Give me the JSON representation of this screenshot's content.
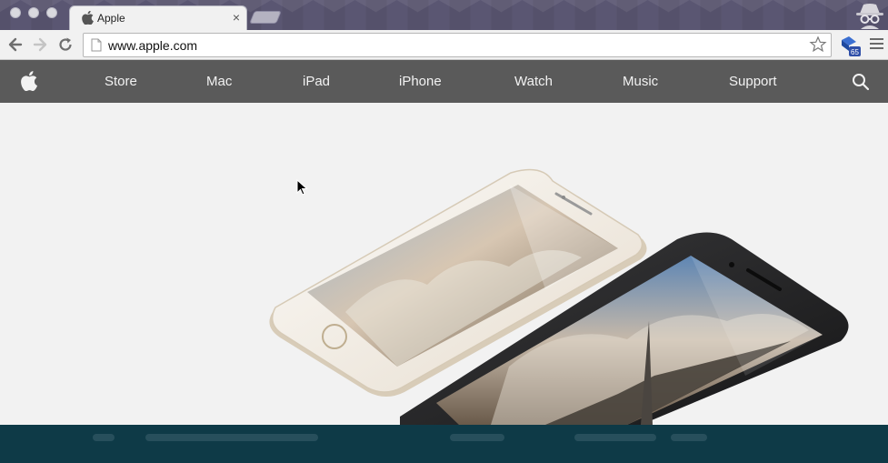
{
  "browser": {
    "tab_title": "Apple",
    "tab_close_glyph": "×",
    "url": "www.apple.com",
    "extension_badge": "65"
  },
  "nav": {
    "items": [
      "Store",
      "Mac",
      "iPad",
      "iPhone",
      "Watch",
      "Music",
      "Support"
    ]
  },
  "colors": {
    "titlebar": "#5a5672",
    "nav_bg": "#5a5a5a",
    "hero_bg": "#f2f2f2",
    "bottom_strip": "#0e3a47"
  },
  "icons": {
    "back": "back-arrow-icon",
    "forward": "forward-arrow-icon",
    "reload": "reload-icon",
    "bookmark": "star-icon",
    "menu": "hamburger-menu-icon",
    "search": "search-icon",
    "logo": "apple-logo-icon"
  }
}
